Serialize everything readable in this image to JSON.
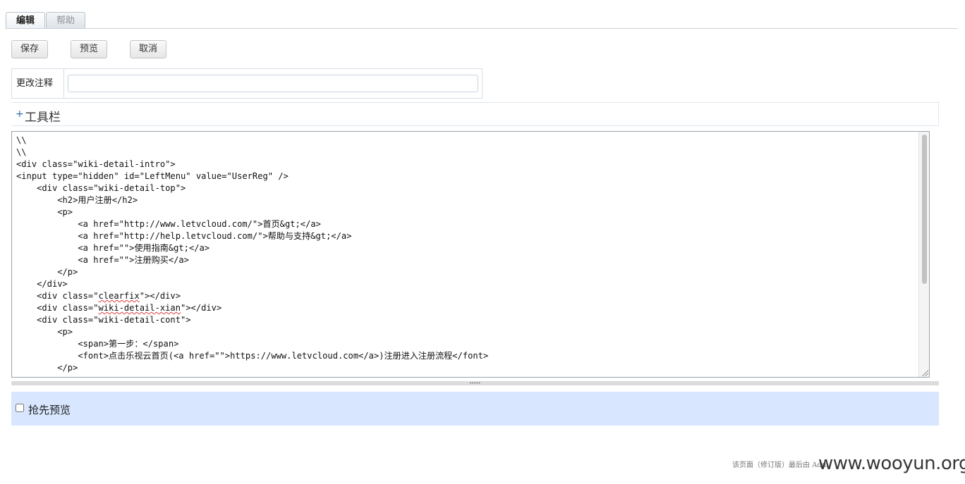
{
  "tabs": {
    "edit": "编辑",
    "help": "帮助"
  },
  "buttons": {
    "save": "保存",
    "preview": "预览",
    "cancel": "取消"
  },
  "change_note": {
    "label": "更改注释",
    "value": "",
    "placeholder": ""
  },
  "toolbar": {
    "toggle": "+",
    "title": "工具栏"
  },
  "editor": {
    "lines": [
      "\\\\",
      "\\\\",
      "<div class=\"wiki-detail-intro\">",
      "<input type=\"hidden\" id=\"LeftMenu\" value=\"UserReg\" />",
      "    <div class=\"wiki-detail-top\">",
      "        <h2>用户注册</h2>",
      "        <p>",
      "            <a href=\"http://www.letvcloud.com/\">首页&gt;</a>",
      "            <a href=\"http://help.letvcloud.com/\">帮助与支持&gt;</a>",
      "            <a href=\"\">使用指南&gt;</a>",
      "            <a href=\"\">注册购买</a>",
      "        </p>",
      "    </div>",
      "    <div class=\"clearfix\"></div>",
      "    <div class=\"wiki-detail-xian\"></div>",
      "    <div class=\"wiki-detail-cont\">",
      "        <p>",
      "            <span>第一步：</span>",
      "            <font>点击乐视云首页(<a href=\"\">https://www.letvcloud.com</a>)注册进入注册流程</font>",
      "        </p>"
    ],
    "misspelled": [
      "clearfix",
      "wiki-detail-xian"
    ]
  },
  "preview": {
    "label": "抢先预览",
    "checked": false
  },
  "footer": {
    "text": "该页面（修订版）最后由 Adm"
  },
  "watermark": "www.wooyun.org"
}
